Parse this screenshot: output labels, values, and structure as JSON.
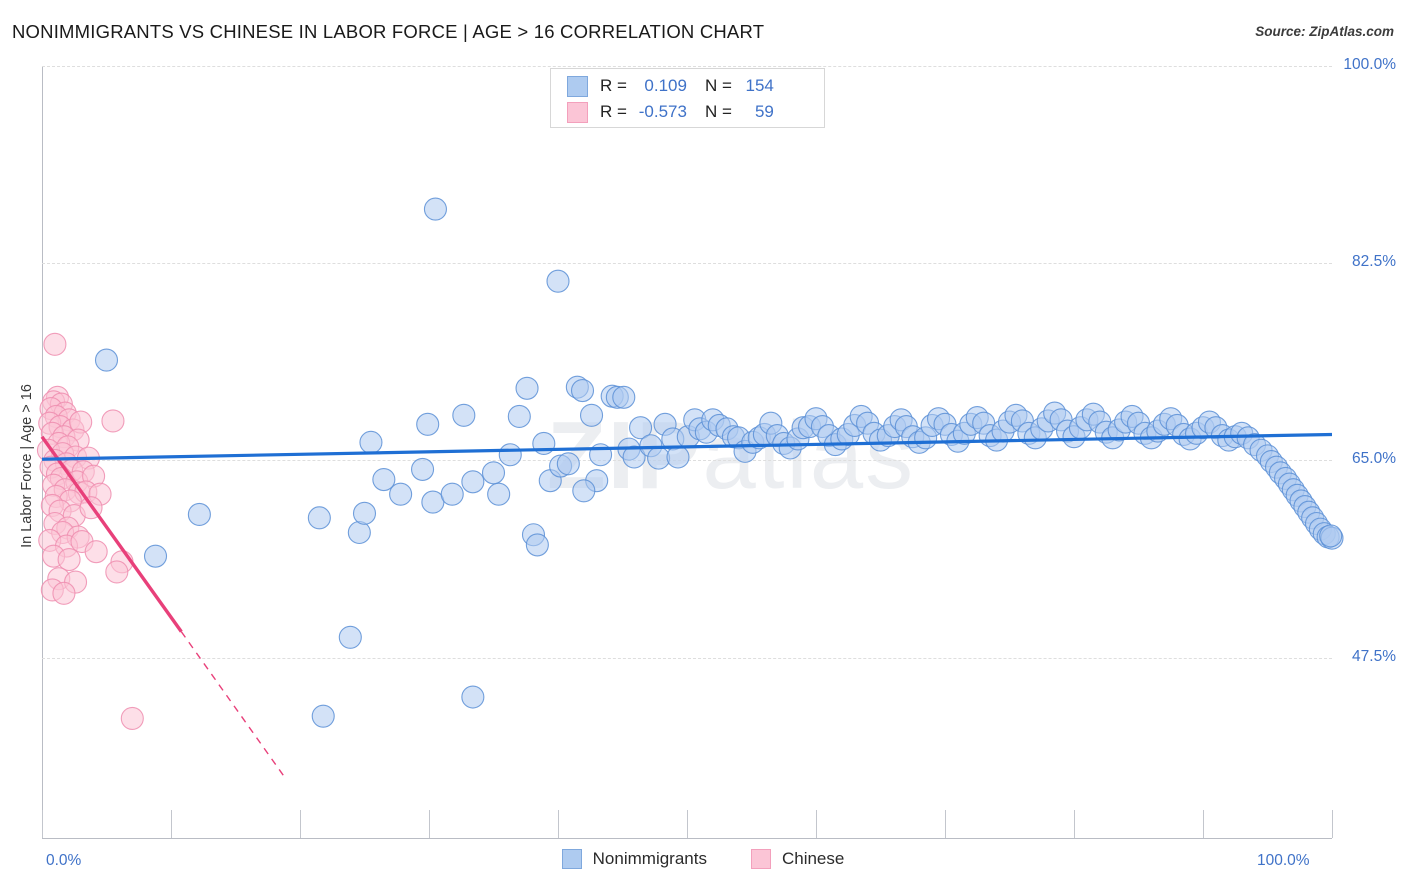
{
  "header": {
    "title": "NONIMMIGRANTS VS CHINESE IN LABOR FORCE | AGE > 16 CORRELATION CHART",
    "source": "Source: ZipAtlas.com"
  },
  "watermark": {
    "bold": "ZIP",
    "thin": "atlas"
  },
  "stats_legend": {
    "rows": [
      {
        "swatch": "blue",
        "r_label": "R =",
        "r_value": "0.109",
        "n_label": "N =",
        "n_value": "154"
      },
      {
        "swatch": "pink",
        "r_label": "R =",
        "r_value": "-0.573",
        "n_label": "N =",
        "n_value": "59"
      }
    ]
  },
  "bottom_legend": {
    "items": [
      {
        "label": "Nonimmigrants",
        "color": "#aecbf0"
      },
      {
        "label": "Chinese",
        "color": "#fbc5d6"
      }
    ]
  },
  "colors": {
    "blue_fill": "#aecbf0",
    "blue_stroke": "#5b8fd6",
    "pink_fill": "#fbc5d6",
    "pink_stroke": "#ef8daf",
    "blue_trend": "#1f6fd4",
    "pink_trend": "#e8407a",
    "tick_text": "#3f72c8",
    "grid": "#dedede"
  },
  "chart_data": {
    "type": "scatter",
    "title": "NONIMMIGRANTS VS CHINESE IN LABOR FORCE | AGE > 16 CORRELATION CHART",
    "xlabel": "",
    "ylabel": "In Labor Force | Age > 16",
    "xlim": [
      0,
      100
    ],
    "ylim": [
      31.4,
      100.0
    ],
    "grid": true,
    "x_ticks": [
      0,
      100
    ],
    "x_tick_labels": [
      "0.0%",
      "100.0%"
    ],
    "y_ticks": [
      47.5,
      65.0,
      82.5,
      100.0
    ],
    "y_tick_labels": [
      "47.5%",
      "65.0%",
      "82.5%",
      "100.0%"
    ],
    "legend_position": "bottom-center",
    "series": [
      {
        "name": "Nonimmigrants",
        "color": "#aecbf0",
        "r": 0.109,
        "n": 154,
        "trendline": {
          "x0": 0,
          "y0": 65.1,
          "x1": 100,
          "y1": 67.3
        },
        "points": [
          [
            5.0,
            73.9
          ],
          [
            12.2,
            60.2
          ],
          [
            8.8,
            56.5
          ],
          [
            21.5,
            59.9
          ],
          [
            24.6,
            58.6
          ],
          [
            23.9,
            49.3
          ],
          [
            21.8,
            42.3
          ],
          [
            25.0,
            60.3
          ],
          [
            25.5,
            66.6
          ],
          [
            26.5,
            63.3
          ],
          [
            27.8,
            62.0
          ],
          [
            29.5,
            64.2
          ],
          [
            29.9,
            68.2
          ],
          [
            30.3,
            61.3
          ],
          [
            31.8,
            62.0
          ],
          [
            32.7,
            69.0
          ],
          [
            33.4,
            63.1
          ],
          [
            30.5,
            87.3
          ],
          [
            35.4,
            62.0
          ],
          [
            36.3,
            65.5
          ],
          [
            35.0,
            63.9
          ],
          [
            37.6,
            71.4
          ],
          [
            38.9,
            66.5
          ],
          [
            37.0,
            68.9
          ],
          [
            39.4,
            63.2
          ],
          [
            40.2,
            64.5
          ],
          [
            40.8,
            64.7
          ],
          [
            38.1,
            58.4
          ],
          [
            38.4,
            57.5
          ],
          [
            33.4,
            44.0
          ],
          [
            41.5,
            71.5
          ],
          [
            41.9,
            71.2
          ],
          [
            42.6,
            69.0
          ],
          [
            43.0,
            63.2
          ],
          [
            43.3,
            65.5
          ],
          [
            40.0,
            80.9
          ],
          [
            44.2,
            70.7
          ],
          [
            44.6,
            70.6
          ],
          [
            45.1,
            70.6
          ],
          [
            45.5,
            66.0
          ],
          [
            45.9,
            65.3
          ],
          [
            42.0,
            62.3
          ],
          [
            46.4,
            67.9
          ],
          [
            47.2,
            66.3
          ],
          [
            47.8,
            65.2
          ],
          [
            48.3,
            68.2
          ],
          [
            48.9,
            66.9
          ],
          [
            49.3,
            65.3
          ],
          [
            50.1,
            67.1
          ],
          [
            50.6,
            68.6
          ],
          [
            51.0,
            67.8
          ],
          [
            51.5,
            67.5
          ],
          [
            52.0,
            68.6
          ],
          [
            52.5,
            68.1
          ],
          [
            53.1,
            67.8
          ],
          [
            53.6,
            67.1
          ],
          [
            54.0,
            67.0
          ],
          [
            54.5,
            65.8
          ],
          [
            55.1,
            66.6
          ],
          [
            55.6,
            67.0
          ],
          [
            56.0,
            67.3
          ],
          [
            56.5,
            68.3
          ],
          [
            57.0,
            67.2
          ],
          [
            57.5,
            66.5
          ],
          [
            58.0,
            66.1
          ],
          [
            58.6,
            66.9
          ],
          [
            59.0,
            67.9
          ],
          [
            59.5,
            68.0
          ],
          [
            60.0,
            68.7
          ],
          [
            60.5,
            68.0
          ],
          [
            61.0,
            67.2
          ],
          [
            61.5,
            66.4
          ],
          [
            62.0,
            66.9
          ],
          [
            62.5,
            67.3
          ],
          [
            63.0,
            68.1
          ],
          [
            63.5,
            68.9
          ],
          [
            64.0,
            68.3
          ],
          [
            64.5,
            67.4
          ],
          [
            65.0,
            66.8
          ],
          [
            65.6,
            67.2
          ],
          [
            66.1,
            68.0
          ],
          [
            66.6,
            68.6
          ],
          [
            67.0,
            68.0
          ],
          [
            67.5,
            67.1
          ],
          [
            68.0,
            66.6
          ],
          [
            68.5,
            67.0
          ],
          [
            69.0,
            68.1
          ],
          [
            69.5,
            68.7
          ],
          [
            70.0,
            68.2
          ],
          [
            70.5,
            67.3
          ],
          [
            71.0,
            66.7
          ],
          [
            71.5,
            67.4
          ],
          [
            72.0,
            68.2
          ],
          [
            72.5,
            68.8
          ],
          [
            73.0,
            68.3
          ],
          [
            73.5,
            67.2
          ],
          [
            74.0,
            66.8
          ],
          [
            74.5,
            67.6
          ],
          [
            75.0,
            68.4
          ],
          [
            75.5,
            69.0
          ],
          [
            76.0,
            68.5
          ],
          [
            76.5,
            67.4
          ],
          [
            77.0,
            67.0
          ],
          [
            77.5,
            67.8
          ],
          [
            78.0,
            68.5
          ],
          [
            78.5,
            69.2
          ],
          [
            79.0,
            68.6
          ],
          [
            79.5,
            67.6
          ],
          [
            80.0,
            67.1
          ],
          [
            80.5,
            67.9
          ],
          [
            81.0,
            68.6
          ],
          [
            81.5,
            69.1
          ],
          [
            82.0,
            68.4
          ],
          [
            82.5,
            67.5
          ],
          [
            83.0,
            67.0
          ],
          [
            83.5,
            67.7
          ],
          [
            84.0,
            68.4
          ],
          [
            84.5,
            68.9
          ],
          [
            85.0,
            68.3
          ],
          [
            85.5,
            67.4
          ],
          [
            86.0,
            67.0
          ],
          [
            86.5,
            67.6
          ],
          [
            87.0,
            68.2
          ],
          [
            87.5,
            68.7
          ],
          [
            88.0,
            68.1
          ],
          [
            88.5,
            67.3
          ],
          [
            89.0,
            66.9
          ],
          [
            89.5,
            67.4
          ],
          [
            90.0,
            67.9
          ],
          [
            90.5,
            68.4
          ],
          [
            91.0,
            67.9
          ],
          [
            91.5,
            67.2
          ],
          [
            92.0,
            66.8
          ],
          [
            92.5,
            67.1
          ],
          [
            93.0,
            67.4
          ],
          [
            93.5,
            67.0
          ],
          [
            94.0,
            66.4
          ],
          [
            94.5,
            65.9
          ],
          [
            95.0,
            65.4
          ],
          [
            95.3,
            64.9
          ],
          [
            95.7,
            64.4
          ],
          [
            96.0,
            63.9
          ],
          [
            96.4,
            63.4
          ],
          [
            96.7,
            62.9
          ],
          [
            97.0,
            62.4
          ],
          [
            97.3,
            61.9
          ],
          [
            97.6,
            61.4
          ],
          [
            97.9,
            60.9
          ],
          [
            98.2,
            60.4
          ],
          [
            98.5,
            59.9
          ],
          [
            98.8,
            59.4
          ],
          [
            99.1,
            58.9
          ],
          [
            99.4,
            58.5
          ],
          [
            99.7,
            58.2
          ],
          [
            100.0,
            58.1
          ],
          [
            99.9,
            58.3
          ]
        ]
      },
      {
        "name": "Chinese",
        "color": "#fbc5d6",
        "r": -0.573,
        "n": 59,
        "trendline": {
          "x0": 0,
          "y0": 67.1,
          "x1": 10.8,
          "y1": 49.8
        },
        "trendline_dashed": {
          "x0": 10.8,
          "y0": 49.8,
          "x1": 18.8,
          "y1": 36.9
        },
        "points": [
          [
            1.0,
            75.3
          ],
          [
            1.2,
            70.6
          ],
          [
            0.9,
            70.2
          ],
          [
            1.5,
            70.0
          ],
          [
            0.7,
            69.6
          ],
          [
            1.8,
            69.2
          ],
          [
            1.1,
            68.9
          ],
          [
            2.1,
            68.6
          ],
          [
            0.6,
            68.3
          ],
          [
            1.4,
            68.0
          ],
          [
            2.4,
            67.7
          ],
          [
            0.8,
            67.4
          ],
          [
            1.7,
            67.1
          ],
          [
            3.0,
            68.4
          ],
          [
            5.5,
            68.5
          ],
          [
            2.8,
            66.8
          ],
          [
            1.3,
            66.5
          ],
          [
            2.0,
            66.2
          ],
          [
            0.5,
            65.9
          ],
          [
            1.6,
            65.6
          ],
          [
            2.6,
            65.3
          ],
          [
            1.0,
            65.0
          ],
          [
            3.6,
            65.2
          ],
          [
            1.9,
            64.7
          ],
          [
            0.7,
            64.4
          ],
          [
            2.3,
            64.1
          ],
          [
            1.2,
            63.8
          ],
          [
            3.2,
            64.0
          ],
          [
            1.5,
            63.4
          ],
          [
            2.7,
            63.1
          ],
          [
            0.9,
            62.8
          ],
          [
            4.0,
            63.6
          ],
          [
            1.8,
            62.4
          ],
          [
            2.9,
            62.1
          ],
          [
            1.1,
            61.8
          ],
          [
            3.4,
            62.2
          ],
          [
            2.2,
            61.4
          ],
          [
            0.8,
            61.0
          ],
          [
            4.5,
            62.0
          ],
          [
            1.4,
            60.5
          ],
          [
            2.5,
            60.1
          ],
          [
            3.8,
            60.8
          ],
          [
            1.0,
            59.4
          ],
          [
            2.0,
            59.0
          ],
          [
            1.6,
            58.6
          ],
          [
            0.6,
            57.9
          ],
          [
            2.8,
            58.2
          ],
          [
            1.9,
            57.4
          ],
          [
            3.1,
            57.8
          ],
          [
            0.9,
            56.5
          ],
          [
            2.1,
            56.2
          ],
          [
            4.2,
            56.9
          ],
          [
            6.2,
            56.0
          ],
          [
            1.3,
            54.5
          ],
          [
            2.6,
            54.2
          ],
          [
            0.8,
            53.5
          ],
          [
            1.7,
            53.2
          ],
          [
            7.0,
            42.1
          ],
          [
            5.8,
            55.1
          ]
        ]
      }
    ]
  }
}
